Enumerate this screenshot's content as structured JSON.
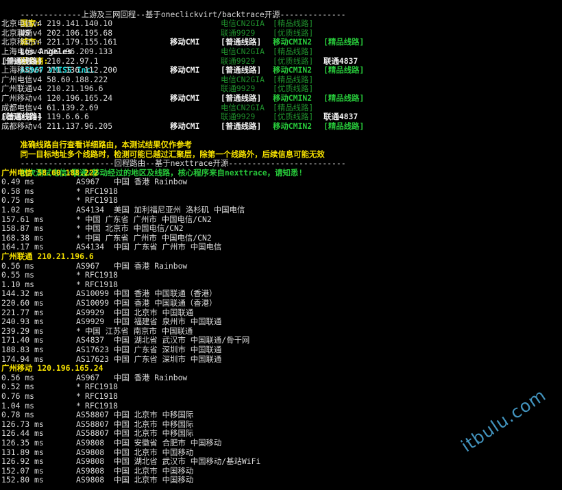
{
  "header": {
    "title_rule": "-------------上游及三网回程--基于oneclickvirt/backtrace开源--------------",
    "country_label": "国家:",
    "country_value": "US",
    "city_label": "城市:",
    "city_value": "Los Angeles",
    "provider_label": "服务商:",
    "provider_value": "AS967 VMISS Inc."
  },
  "backtrace_rows": [
    {
      "name": "北京电信v4 219.141.140.10",
      "cols": [
        {
          "t": "",
          "c": ""
        },
        {
          "t": "电信CN2GIA",
          "c": "dgreen"
        },
        {
          "t": "[精品线路]",
          "c": "dgreen"
        },
        {
          "t": "",
          "c": ""
        }
      ]
    },
    {
      "name": "北京联通v4 202.106.195.68",
      "cols": [
        {
          "t": "",
          "c": ""
        },
        {
          "t": "联通9929",
          "c": "dgreen"
        },
        {
          "t": "[优质线路]",
          "c": "dgreen"
        },
        {
          "t": "",
          "c": ""
        }
      ]
    },
    {
      "name": "北京移动v4 221.179.155.161",
      "cols": [
        {
          "t": "移动CMI",
          "c": "bold"
        },
        {
          "t": "[普通线路]",
          "c": "bold"
        },
        {
          "t": "移动CMIN2",
          "c": "green"
        },
        {
          "t": "[精品线路]",
          "c": "green"
        }
      ]
    },
    {
      "name": "上海电信v4 202.96.209.133",
      "cols": [
        {
          "t": "",
          "c": ""
        },
        {
          "t": "电信CN2GIA",
          "c": "dgreen"
        },
        {
          "t": "[精品线路]",
          "c": "dgreen"
        },
        {
          "t": "",
          "c": ""
        }
      ]
    },
    {
      "name": "上海联通v4 210.22.97.1",
      "cols": [
        {
          "t": "",
          "c": ""
        },
        {
          "t": "联通9929",
          "c": "dgreen"
        },
        {
          "t": "[优质线路]",
          "c": "dgreen"
        },
        {
          "t": "联通4837",
          "c": "bold"
        },
        {
          "t": "[普通线路]",
          "c": "bold"
        }
      ]
    },
    {
      "name": "上海移动v4 211.136.112.200",
      "cols": [
        {
          "t": "移动CMI",
          "c": "bold"
        },
        {
          "t": "[普通线路]",
          "c": "bold"
        },
        {
          "t": "移动CMIN2",
          "c": "green"
        },
        {
          "t": "[精品线路]",
          "c": "green"
        }
      ]
    },
    {
      "name": "广州电信v4 58.60.188.222",
      "cols": [
        {
          "t": "",
          "c": ""
        },
        {
          "t": "电信CN2GIA",
          "c": "dgreen"
        },
        {
          "t": "[精品线路]",
          "c": "dgreen"
        },
        {
          "t": "",
          "c": ""
        }
      ]
    },
    {
      "name": "广州联通v4 210.21.196.6",
      "cols": [
        {
          "t": "",
          "c": ""
        },
        {
          "t": "联通9929",
          "c": "dgreen"
        },
        {
          "t": "[优质线路]",
          "c": "dgreen"
        },
        {
          "t": "",
          "c": ""
        }
      ]
    },
    {
      "name": "广州移动v4 120.196.165.24",
      "cols": [
        {
          "t": "移动CMI",
          "c": "bold"
        },
        {
          "t": "[普通线路]",
          "c": "bold"
        },
        {
          "t": "移动CMIN2",
          "c": "green"
        },
        {
          "t": "[精品线路]",
          "c": "green"
        }
      ]
    },
    {
      "name": "成都电信v4 61.139.2.69",
      "cols": [
        {
          "t": "",
          "c": ""
        },
        {
          "t": "电信CN2GIA",
          "c": "dgreen"
        },
        {
          "t": "[精品线路]",
          "c": "dgreen"
        },
        {
          "t": "",
          "c": ""
        }
      ]
    },
    {
      "name": "成都联通v4 119.6.6.6",
      "cols": [
        {
          "t": "",
          "c": ""
        },
        {
          "t": "联通9929",
          "c": "dgreen"
        },
        {
          "t": "[优质线路]",
          "c": "dgreen"
        },
        {
          "t": "联通4837",
          "c": "bold"
        },
        {
          "t": "[普通线路]",
          "c": "bold"
        }
      ]
    },
    {
      "name": "成都移动v4 211.137.96.205",
      "cols": [
        {
          "t": "移动CMI",
          "c": "bold"
        },
        {
          "t": "[普通线路]",
          "c": "bold"
        },
        {
          "t": "移动CMIN2",
          "c": "green"
        },
        {
          "t": "[精品线路]",
          "c": "green"
        }
      ]
    }
  ],
  "notes": [
    "准确线路自行查看详细路由，本测试结果仅作参考",
    "同一目标地址多个线路时，检测可能已越过汇聚层，除第一个线路外，后续信息可能无效"
  ],
  "section2_rule": "--------------------回程路由--基于nexttrace开源-------------------------",
  "section2_intro": "依次测试电信/联通/移动经过的地区及线路，核心程序来自nexttrace，请知悉!",
  "traces": [
    {
      "title": "广州电信 58.60.188.222",
      "hops": [
        {
          "ms": "0.49 ms",
          "asn": "AS967",
          "geo": "中国 香港 Rainbow"
        },
        {
          "ms": "0.58 ms",
          "asn": "*",
          "geo": "RFC1918"
        },
        {
          "ms": "0.75 ms",
          "asn": "*",
          "geo": "RFC1918"
        },
        {
          "ms": "1.02 ms",
          "asn": "AS4134",
          "geo": "美国 加利福尼亚州 洛杉矶 中国电信"
        },
        {
          "ms": "157.61 ms",
          "asn": "*",
          "geo": "中国 广东省 广州市 中国电信/CN2"
        },
        {
          "ms": "158.87 ms",
          "asn": "*",
          "geo": "中国 北京市 中国电信/CN2"
        },
        {
          "ms": "168.38 ms",
          "asn": "*",
          "geo": "中国 广东省 广州市 中国电信/CN2"
        },
        {
          "ms": "164.17 ms",
          "asn": "AS4134",
          "geo": "中国 广东省 广州市 中国电信"
        }
      ]
    },
    {
      "title": "广州联通 210.21.196.6",
      "hops": [
        {
          "ms": "0.56 ms",
          "asn": "AS967",
          "geo": "中国 香港 Rainbow"
        },
        {
          "ms": "0.55 ms",
          "asn": "*",
          "geo": "RFC1918"
        },
        {
          "ms": "1.10 ms",
          "asn": "*",
          "geo": "RFC1918"
        },
        {
          "ms": "144.32 ms",
          "asn": "AS10099",
          "geo": "中国 香港 中国联通（香港）"
        },
        {
          "ms": "220.60 ms",
          "asn": "AS10099",
          "geo": "中国 香港 中国联通（香港）"
        },
        {
          "ms": "221.77 ms",
          "asn": "AS9929",
          "geo": "中国 北京市 中国联通"
        },
        {
          "ms": "240.93 ms",
          "asn": "AS9929",
          "geo": "中国 福建省 泉州市 中国联通"
        },
        {
          "ms": "239.29 ms",
          "asn": "*",
          "geo": "中国 江苏省 南京市 中国联通"
        },
        {
          "ms": "171.40 ms",
          "asn": "AS4837",
          "geo": "中国 湖北省 武汉市 中国联通/骨干网"
        },
        {
          "ms": "188.83 ms",
          "asn": "AS17623",
          "geo": "中国 广东省 深圳市 中国联通"
        },
        {
          "ms": "174.94 ms",
          "asn": "AS17623",
          "geo": "中国 广东省 深圳市 中国联通"
        }
      ]
    },
    {
      "title": "广州移动 120.196.165.24",
      "hops": [
        {
          "ms": "0.56 ms",
          "asn": "AS967",
          "geo": "中国 香港 Rainbow"
        },
        {
          "ms": "0.52 ms",
          "asn": "*",
          "geo": "RFC1918"
        },
        {
          "ms": "0.76 ms",
          "asn": "*",
          "geo": "RFC1918"
        },
        {
          "ms": "1.04 ms",
          "asn": "*",
          "geo": "RFC1918"
        },
        {
          "ms": "0.78 ms",
          "asn": "AS58807",
          "geo": "中国 北京市 中移国际"
        },
        {
          "ms": "126.73 ms",
          "asn": "AS58807",
          "geo": "中国 北京市 中移国际"
        },
        {
          "ms": "126.44 ms",
          "asn": "AS58807",
          "geo": "中国 北京市 中移国际"
        },
        {
          "ms": "126.35 ms",
          "asn": "AS9808",
          "geo": "中国 安徽省 合肥市 中国移动"
        },
        {
          "ms": "131.89 ms",
          "asn": "AS9808",
          "geo": "中国 北京市 中国移动"
        },
        {
          "ms": "126.92 ms",
          "asn": "AS9808",
          "geo": "中国 湖北省 武汉市 中国移动/基站WiFi"
        },
        {
          "ms": "152.07 ms",
          "asn": "AS9808",
          "geo": "中国 北京市 中国移动"
        },
        {
          "ms": "152.80 ms",
          "asn": "AS9808",
          "geo": "中国 北京市 中国移动"
        }
      ]
    }
  ],
  "watermark": "itbulu.com"
}
